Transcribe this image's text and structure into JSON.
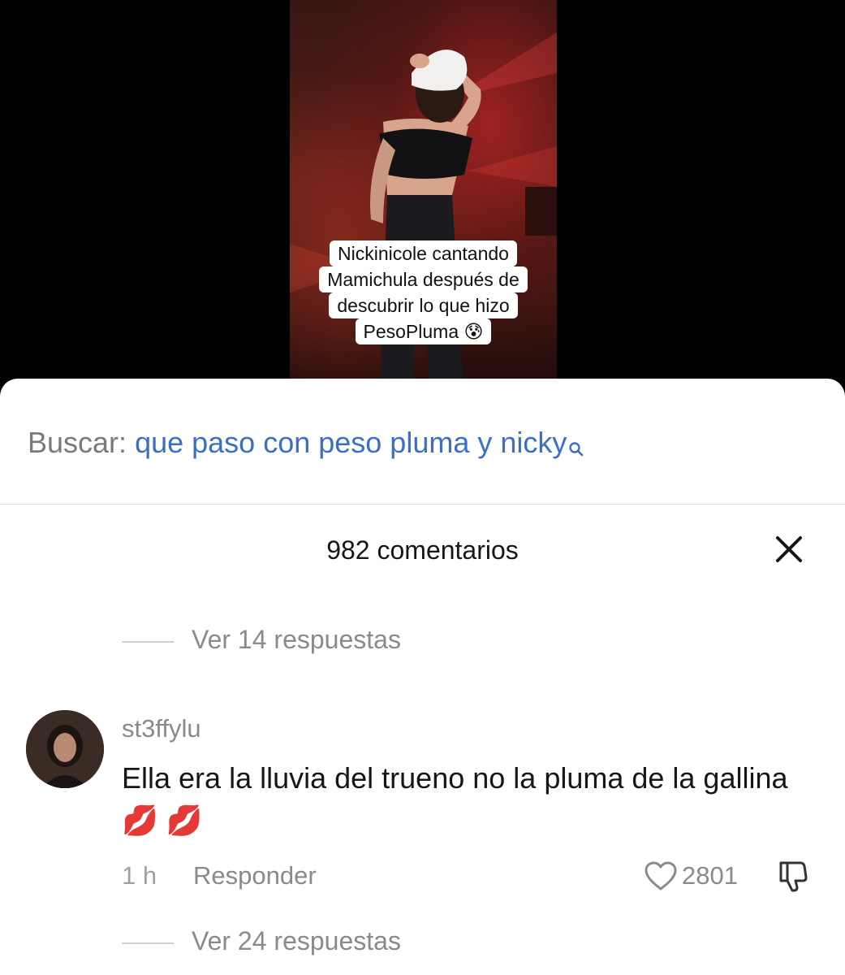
{
  "video": {
    "caption_lines": [
      "Nickinicole cantando",
      "Mamichula después de",
      "descubrir lo que hizo",
      "PesoPluma 😰"
    ]
  },
  "search": {
    "label": "Buscar:",
    "query": "que paso con peso pluma y nicky",
    "icon": "search-icon"
  },
  "comments_panel": {
    "title": "982 comentarios",
    "close_icon": "close-icon",
    "replies_top": "Ver 14 respuestas",
    "comment": {
      "username": "st3ffylu",
      "text": "Ella era la lluvia del trueno no la pluma de la gallina 💋 💋",
      "time": "1 h",
      "reply_label": "Responder",
      "likes": "2801",
      "like_icon": "heart-icon",
      "dislike_icon": "thumbs-down-icon"
    },
    "replies_bottom": "Ver 24 respuestas"
  },
  "colors": {
    "search_query": "#3a6fc7",
    "muted_text": "#8a8a8a",
    "primary_text": "#161616",
    "sheet_background": "#ffffff"
  }
}
